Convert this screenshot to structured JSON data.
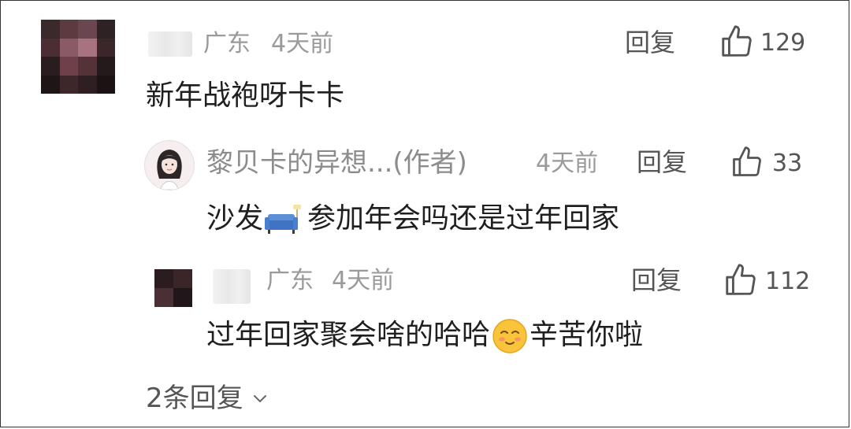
{
  "comment1": {
    "location": "广东",
    "time": "4天前",
    "text": "新年战袍呀卡卡",
    "reply_label": "回复",
    "likes": "129"
  },
  "reply1": {
    "author": "黎贝卡的异想...(作者)",
    "time": "4天前",
    "text_before": "沙发",
    "emoji": "sofa-emoji",
    "text_after": "参加年会吗还是过年回家",
    "reply_label": "回复",
    "likes": "33"
  },
  "reply2": {
    "location": "广东",
    "time": "4天前",
    "text_before": "过年回家聚会啥的哈哈",
    "emoji": "smiling-face-emoji",
    "text_after": "辛苦你啦",
    "reply_label": "回复",
    "likes": "112"
  },
  "more_replies": {
    "label": "2条回复"
  },
  "icons": {
    "like": "thumbs-up-icon",
    "expand": "chevron-down-icon"
  }
}
